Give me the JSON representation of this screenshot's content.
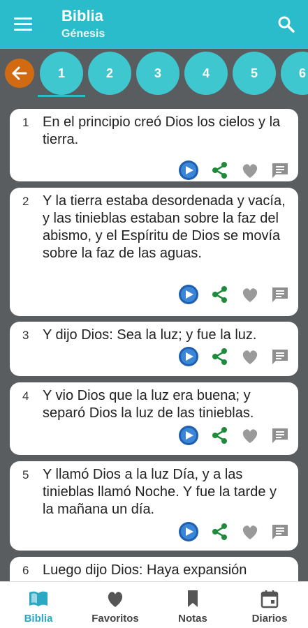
{
  "appbar": {
    "title": "Biblia",
    "subtitle": "Génesis"
  },
  "chapters": [
    "1",
    "2",
    "3",
    "4",
    "5",
    "6"
  ],
  "verses": [
    {
      "num": "1",
      "text": "En el principio creó Dios los cielos y la tierra."
    },
    {
      "num": "2",
      "text": "Y la tierra estaba desordenada y vacía, y las tinieblas estaban sobre la faz del abismo, y el Espíritu de Dios se movía sobre la faz de las aguas."
    },
    {
      "num": "3",
      "text": "Y dijo Dios: Sea la luz; y fue la luz."
    },
    {
      "num": "4",
      "text": "Y vio Dios que la luz era buena; y separó Dios la luz de las tinieblas."
    },
    {
      "num": "5",
      "text": "Y llamó Dios a la luz Día, y a las tinieblas llamó Noche. Y fue la tarde y la mañana un día."
    },
    {
      "num": "6",
      "text": "Luego dijo Dios: Haya expansión"
    }
  ],
  "nav": {
    "biblia": "Biblia",
    "favoritos": "Favoritos",
    "notas": "Notas",
    "diarios": "Diarios"
  },
  "colors": {
    "primary": "#2bbccc",
    "accent": "#d26a12",
    "play": "#1e5fb0",
    "share": "#1e8a3a"
  },
  "icons": [
    "menu-icon",
    "search-icon",
    "arrow-left-icon",
    "play-icon",
    "share-icon",
    "heart-icon",
    "note-icon",
    "book-icon",
    "bookmark-icon",
    "calendar-icon"
  ]
}
